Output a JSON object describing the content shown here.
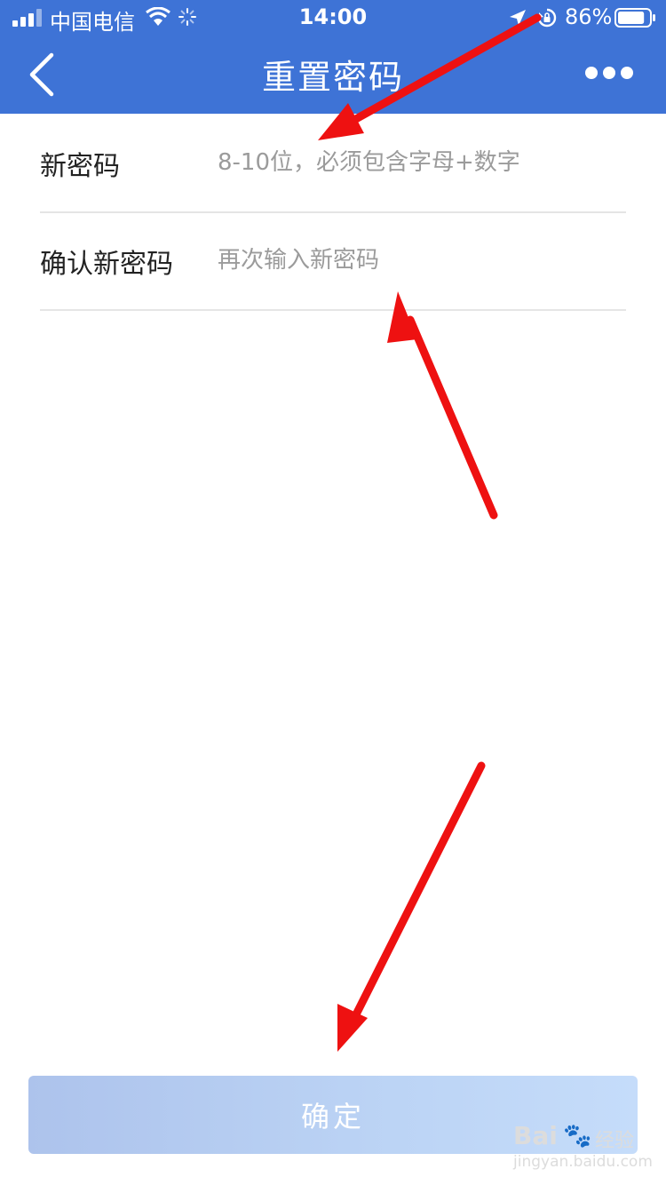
{
  "status_bar": {
    "carrier": "中国电信",
    "time": "14:00",
    "battery": "86%",
    "battery_level": 0.86,
    "icons": [
      "signal-icon",
      "wifi-icon",
      "loading-icon",
      "location-icon",
      "rotation-lock-icon",
      "battery-icon"
    ]
  },
  "header": {
    "title": "重置密码",
    "back_icon": "chevron-left-icon",
    "more_icon": "more-dots-icon",
    "background": "#3e73d6"
  },
  "form": {
    "new_password": {
      "label": "新密码",
      "placeholder": "8-10位，必须包含字母+数字",
      "value": ""
    },
    "confirm_password": {
      "label": "确认新密码",
      "placeholder": "再次输入新密码",
      "value": ""
    }
  },
  "confirm_button": {
    "label": "确定"
  },
  "annotations": {
    "arrow_color": "#ee1111"
  },
  "watermark": {
    "logo": "Bai",
    "name": "经验",
    "url": "jingyan.baidu.com"
  }
}
